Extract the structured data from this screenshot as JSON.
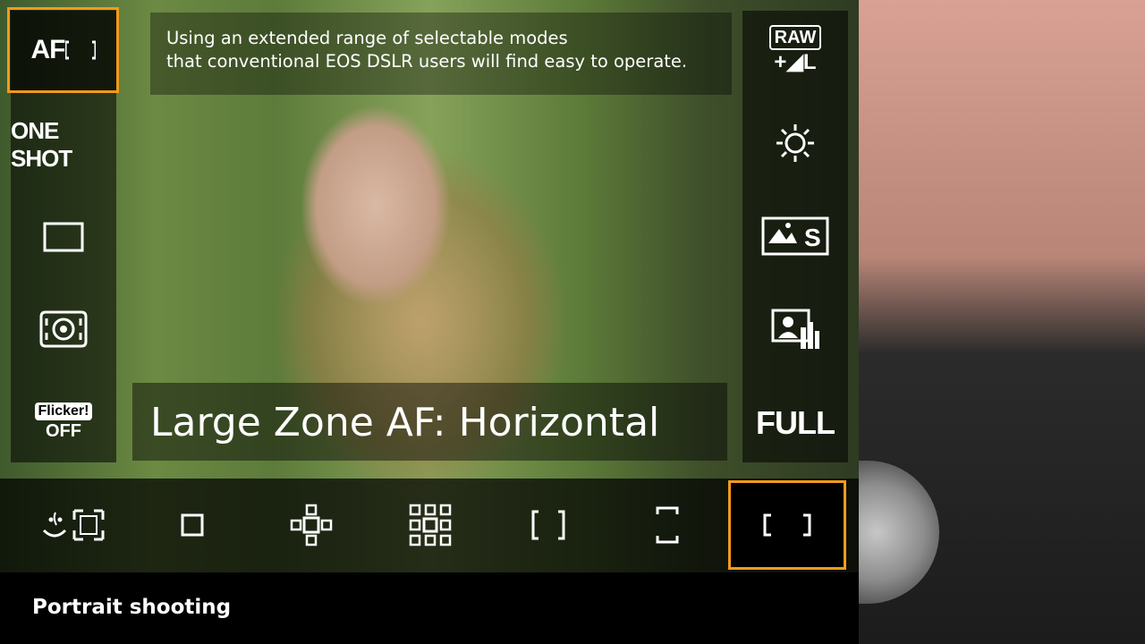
{
  "left_menu": {
    "af_method_label": "AF",
    "af_mode": "ONE SHOT",
    "flicker_top": "Flicker!",
    "flicker_bottom": "OFF"
  },
  "description": "Using an extended range of selectable modes\nthat conventional EOS DSLR users will find easy to operate.",
  "selected_af_area": "Large Zone AF: Horizontal",
  "right_menu": {
    "raw_label": "RAW",
    "size_label": "+◢L",
    "full_label": "FULL"
  },
  "caption": "Portrait shooting",
  "colors": {
    "selection": "#f39a1c"
  }
}
